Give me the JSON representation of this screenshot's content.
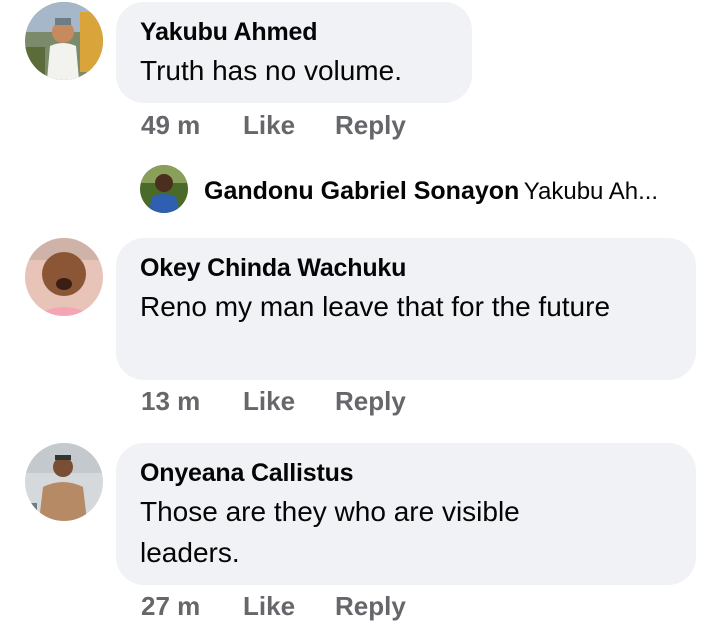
{
  "comments": [
    {
      "author": "Yakubu Ahmed",
      "text": "Truth has no volume.",
      "time": "49 m",
      "like": "Like",
      "reply": "Reply"
    },
    {
      "author": "Okey Chinda Wachuku",
      "text": "Reno my man leave that for the future",
      "time": "13 m",
      "like": "Like",
      "reply": "Reply"
    },
    {
      "author": "Onyeana Callistus",
      "text": "Those are they who are visible leaders.",
      "time": "27 m",
      "like": "Like",
      "reply": "Reply"
    }
  ],
  "reply_preview": {
    "author": "Gandonu Gabriel Sonayon",
    "snippet": "Yakubu Ah..."
  }
}
